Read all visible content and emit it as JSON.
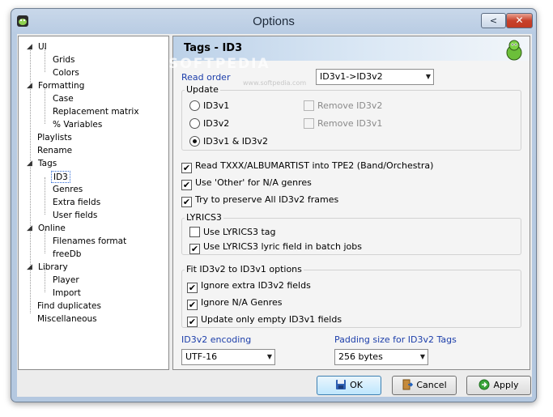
{
  "window": {
    "title": "Options",
    "min_label": "<",
    "close_label": "✕"
  },
  "tree": {
    "items": [
      {
        "label": "UI",
        "exp": "◢"
      },
      {
        "label": "Grids"
      },
      {
        "label": "Colors"
      },
      {
        "label": "Formatting",
        "exp": "◢"
      },
      {
        "label": "Case"
      },
      {
        "label": "Replacement matrix"
      },
      {
        "label": "% Variables"
      },
      {
        "label": "Playlists"
      },
      {
        "label": "Rename"
      },
      {
        "label": "Tags",
        "exp": "◢"
      },
      {
        "label": "ID3"
      },
      {
        "label": "Genres"
      },
      {
        "label": "Extra fields"
      },
      {
        "label": "User fields"
      },
      {
        "label": "Online",
        "exp": "◢"
      },
      {
        "label": "Filenames format"
      },
      {
        "label": "freeDb"
      },
      {
        "label": "Library",
        "exp": "◢"
      },
      {
        "label": "Player"
      },
      {
        "label": "Import"
      },
      {
        "label": "Find duplicates"
      },
      {
        "label": "Miscellaneous"
      }
    ]
  },
  "panel": {
    "title": "Tags - ID3",
    "watermark": "SOFTPEDIA",
    "watermark_sub": "www.softpedia.com",
    "read_order_label": "Read order",
    "read_order_value": "ID3v1->ID3v2",
    "update_group": "Update",
    "radio_id3v1": "ID3v1",
    "radio_id3v2": "ID3v2",
    "radio_both": "ID3v1 & ID3v2",
    "remove_id3v2": "Remove ID3v2",
    "remove_id3v1": "Remove ID3v1",
    "chk_txxx": "Read TXXX/ALBUMARTIST into TPE2 (Band/Orchestra)",
    "chk_other": "Use 'Other' for N/A genres",
    "chk_preserve": "Try to preserve All ID3v2 frames",
    "lyrics_group": "LYRICS3",
    "chk_lyrics_tag": "Use LYRICS3 tag",
    "chk_lyrics_batch": "Use LYRICS3 lyric field in batch jobs",
    "fit_group": "Fit ID3v2 to ID3v1 options",
    "chk_ignore_extra": "Ignore extra ID3v2 fields",
    "chk_ignore_na": "Ignore N/A Genres",
    "chk_update_empty": "Update only empty ID3v1 fields",
    "encoding_label": "ID3v2 encoding",
    "encoding_value": "UTF-16",
    "padding_label": "Padding size for ID3v2 Tags",
    "padding_value": "256 bytes"
  },
  "buttons": {
    "ok": "OK",
    "cancel": "Cancel",
    "apply": "Apply"
  },
  "check_mark": "✔",
  "colors": {
    "accent_blue": "#1c3eaa",
    "selection_border": "#2f6bd6"
  }
}
